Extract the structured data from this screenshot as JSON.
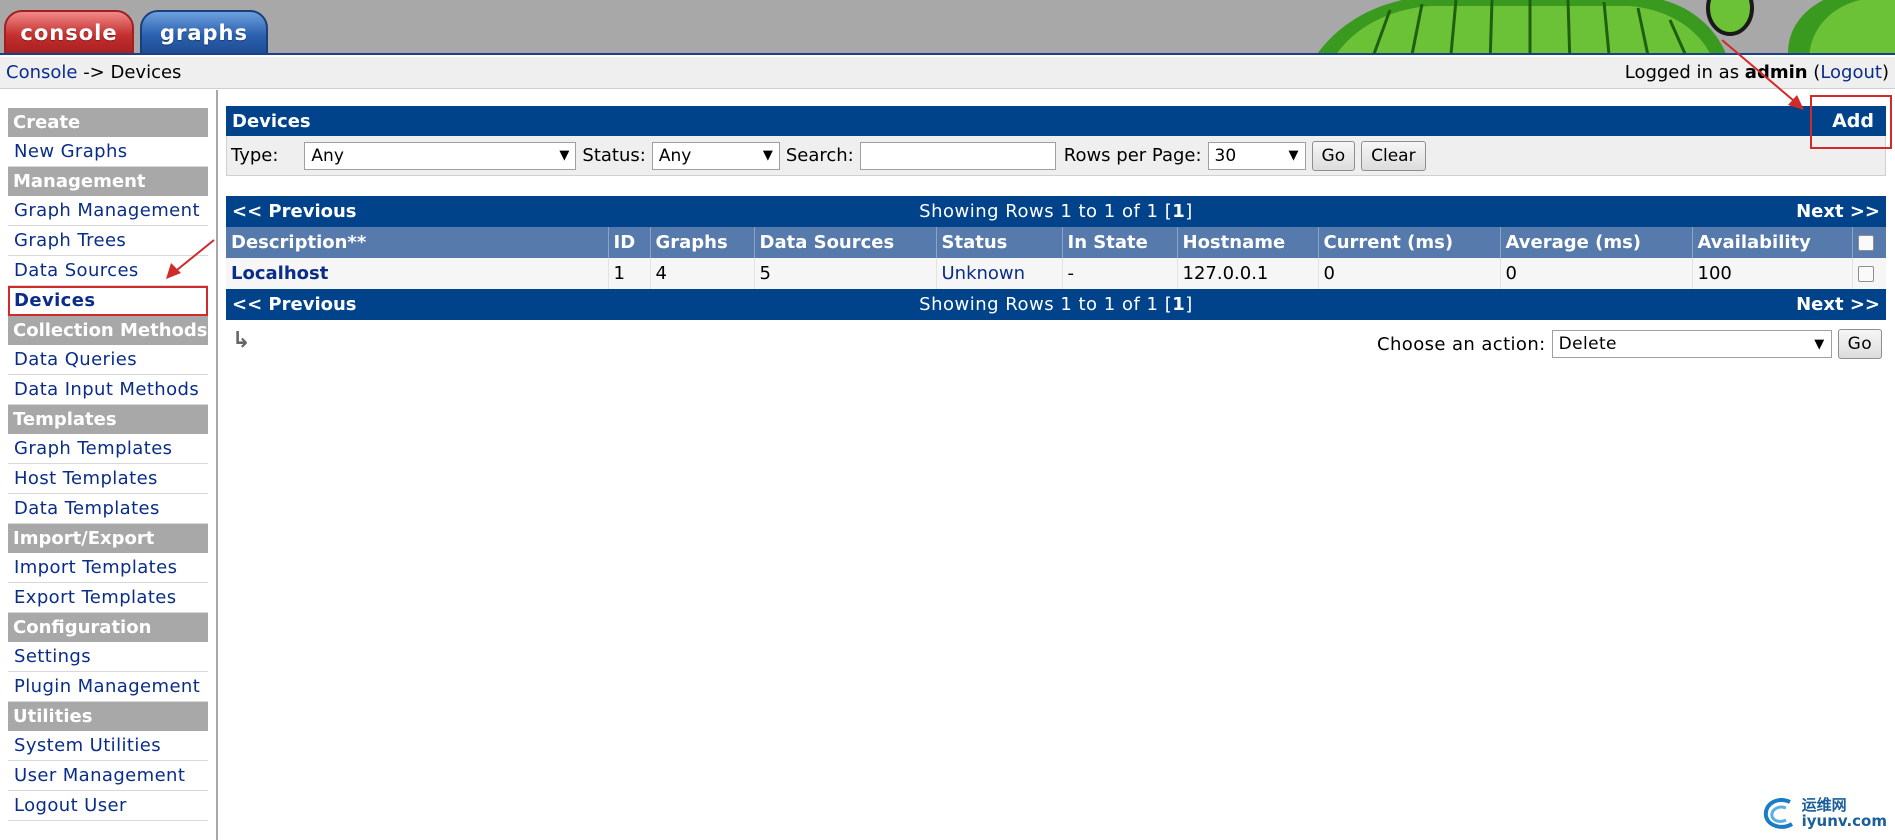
{
  "tabs": {
    "console": "console",
    "graphs": "graphs"
  },
  "breadcrumb": {
    "root": "Console",
    "separator": " -> ",
    "current": "Devices"
  },
  "login": {
    "prefix": "Logged in as ",
    "user": "admin",
    "open": " (",
    "logout": "Logout",
    "close": ")"
  },
  "sidebar": {
    "create": {
      "heading": "Create",
      "items": [
        "New Graphs"
      ]
    },
    "management": {
      "heading": "Management",
      "items": [
        "Graph Management",
        "Graph Trees",
        "Data Sources",
        "Devices"
      ]
    },
    "collection": {
      "heading": "Collection Methods",
      "items": [
        "Data Queries",
        "Data Input Methods"
      ]
    },
    "templates": {
      "heading": "Templates",
      "items": [
        "Graph Templates",
        "Host Templates",
        "Data Templates"
      ]
    },
    "importexport": {
      "heading": "Import/Export",
      "items": [
        "Import Templates",
        "Export Templates"
      ]
    },
    "configuration": {
      "heading": "Configuration",
      "items": [
        "Settings",
        "Plugin Management"
      ]
    },
    "utilities": {
      "heading": "Utilities",
      "items": [
        "System Utilities",
        "User Management",
        "Logout User"
      ]
    },
    "active_item": "Devices"
  },
  "devices_panel": {
    "title": "Devices",
    "add_label": "Add"
  },
  "filter": {
    "type_label": "Type:",
    "type_value": "Any",
    "status_label": "Status:",
    "status_value": "Any",
    "search_label": "Search:",
    "search_value": "",
    "rows_label": "Rows per Page:",
    "rows_value": "30",
    "go_label": "Go",
    "clear_label": "Clear"
  },
  "pager": {
    "prev": "<< Previous",
    "next": "Next >>",
    "showing": "Showing Rows 1 to 1 of 1 [",
    "page": "1",
    "showing_end": "]"
  },
  "table": {
    "columns": [
      "Description**",
      "ID",
      "Graphs",
      "Data Sources",
      "Status",
      "In State",
      "Hostname",
      "Current (ms)",
      "Average (ms)",
      "Availability"
    ],
    "rows": [
      {
        "description": "Localhost",
        "id": "1",
        "graphs": "4",
        "data_sources": "5",
        "status": "Unknown",
        "in_state": "-",
        "hostname": "127.0.0.1",
        "current": "0",
        "average": "0",
        "availability": "100"
      }
    ]
  },
  "action": {
    "label": "Choose an action:",
    "value": "Delete",
    "go_label": "Go"
  },
  "watermark": {
    "line1": "运维网",
    "line2": "iyunv.com"
  },
  "colors": {
    "header_blue": "#00438a",
    "column_blue": "#567aab",
    "sidebar_gray": "#a8a8a8",
    "link": "#0a2d8a",
    "annotation_red": "#d12a2a"
  }
}
